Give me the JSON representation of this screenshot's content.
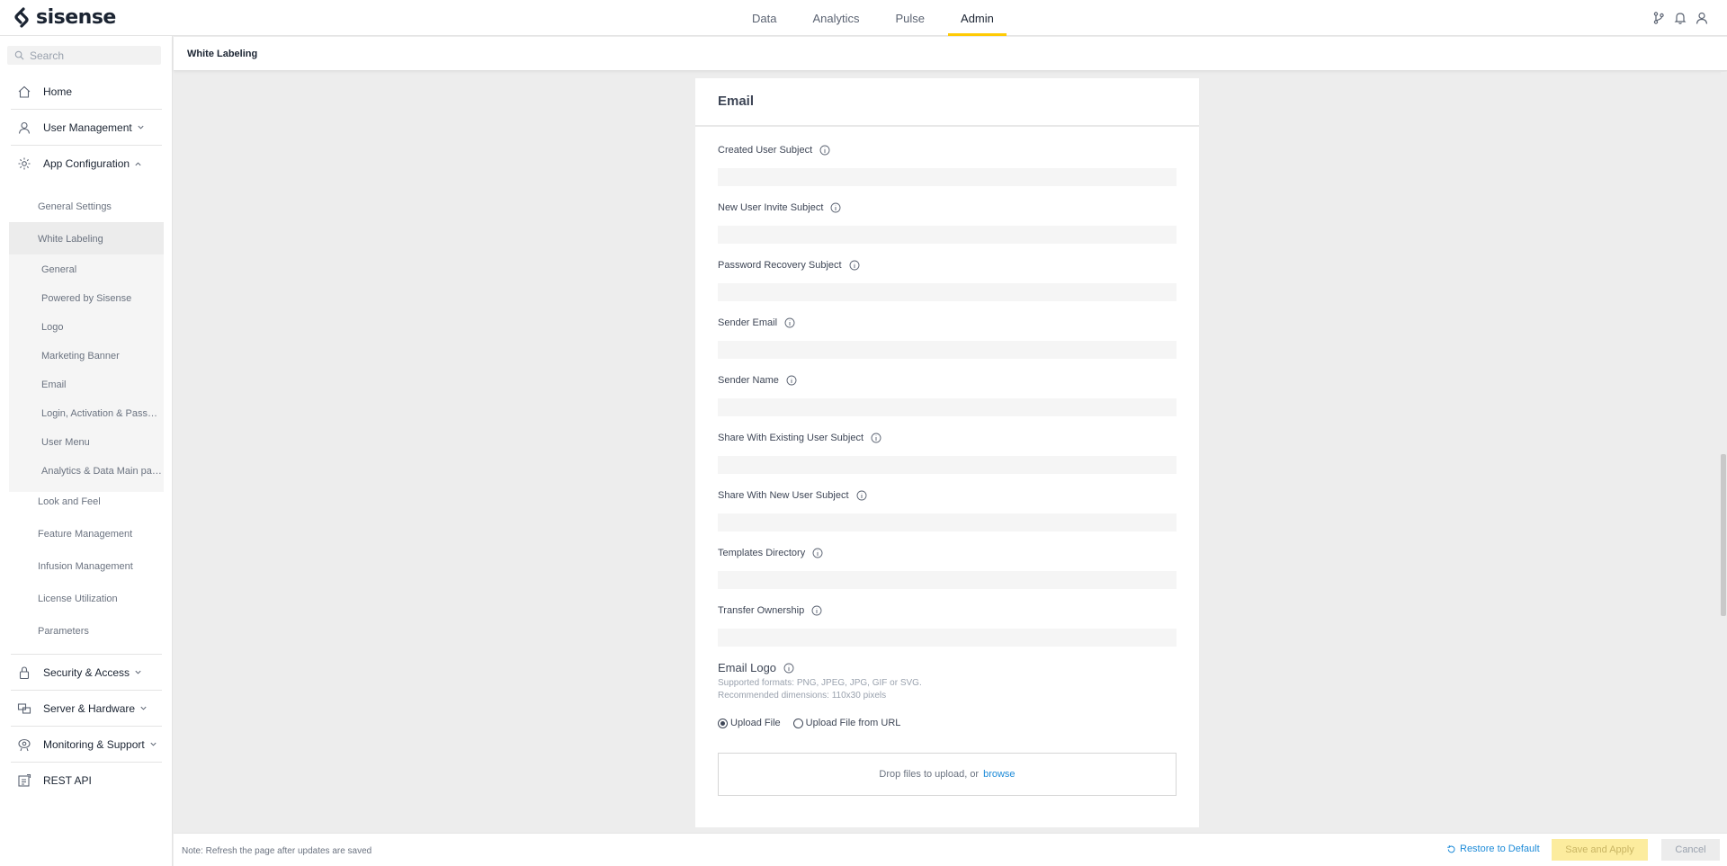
{
  "brand": {
    "name": "sisense",
    "accent": "#ffcb05",
    "link": "#1d8bd8"
  },
  "topnav": [
    {
      "label": "Data"
    },
    {
      "label": "Analytics"
    },
    {
      "label": "Pulse"
    },
    {
      "label": "Admin",
      "active": true
    }
  ],
  "top_icons": [
    "git-branch-icon",
    "bell-icon",
    "user-icon"
  ],
  "sidebar": {
    "search_placeholder": "Search",
    "home": "Home",
    "user_management": "User Management",
    "app_configuration": "App Configuration",
    "app_config_items": {
      "general_settings": "General Settings",
      "white_labeling": "White Labeling",
      "look_and_feel": "Look and Feel",
      "feature_management": "Feature Management",
      "infusion_management": "Infusion Management",
      "license_utilization": "License Utilization",
      "parameters": "Parameters"
    },
    "white_labeling_items": {
      "general": "General",
      "powered_by": "Powered by Sisense",
      "logo": "Logo",
      "marketing_banner": "Marketing Banner",
      "email": "Email",
      "login": "Login, Activation & Password",
      "user_menu": "User Menu",
      "analytics_main": "Analytics & Data Main page"
    },
    "security_access": "Security & Access",
    "server_hardware": "Server & Hardware",
    "monitoring_support": "Monitoring & Support",
    "rest_api": "REST API"
  },
  "page": {
    "title": "White Labeling"
  },
  "email_card": {
    "title": "Email",
    "fields": {
      "created_user_subject": {
        "label": "Created User Subject",
        "value": ""
      },
      "new_user_invite_subject": {
        "label": "New User Invite Subject",
        "value": ""
      },
      "password_recovery_subject": {
        "label": "Password Recovery Subject",
        "value": ""
      },
      "sender_email": {
        "label": "Sender Email",
        "value": ""
      },
      "sender_name": {
        "label": "Sender Name",
        "value": ""
      },
      "share_existing_subject": {
        "label": "Share With Existing User Subject",
        "value": ""
      },
      "share_new_subject": {
        "label": "Share With New User Subject",
        "value": ""
      },
      "templates_directory": {
        "label": "Templates Directory",
        "value": ""
      },
      "transfer_ownership": {
        "label": "Transfer Ownership",
        "value": ""
      }
    },
    "email_logo": {
      "label": "Email Logo",
      "formats": "Supported formats: PNG, JPEG, JPG, GIF or SVG.",
      "dimensions": "Recommended dimensions: 110x30 pixels",
      "option_upload": "Upload File",
      "option_url": "Upload File from URL",
      "selected": "upload",
      "drop_text": "Drop files to upload, or",
      "browse": "browse"
    }
  },
  "footer": {
    "note": "Note: Refresh the page after updates are saved",
    "restore": "Restore to Default",
    "save": "Save and Apply",
    "cancel": "Cancel"
  }
}
